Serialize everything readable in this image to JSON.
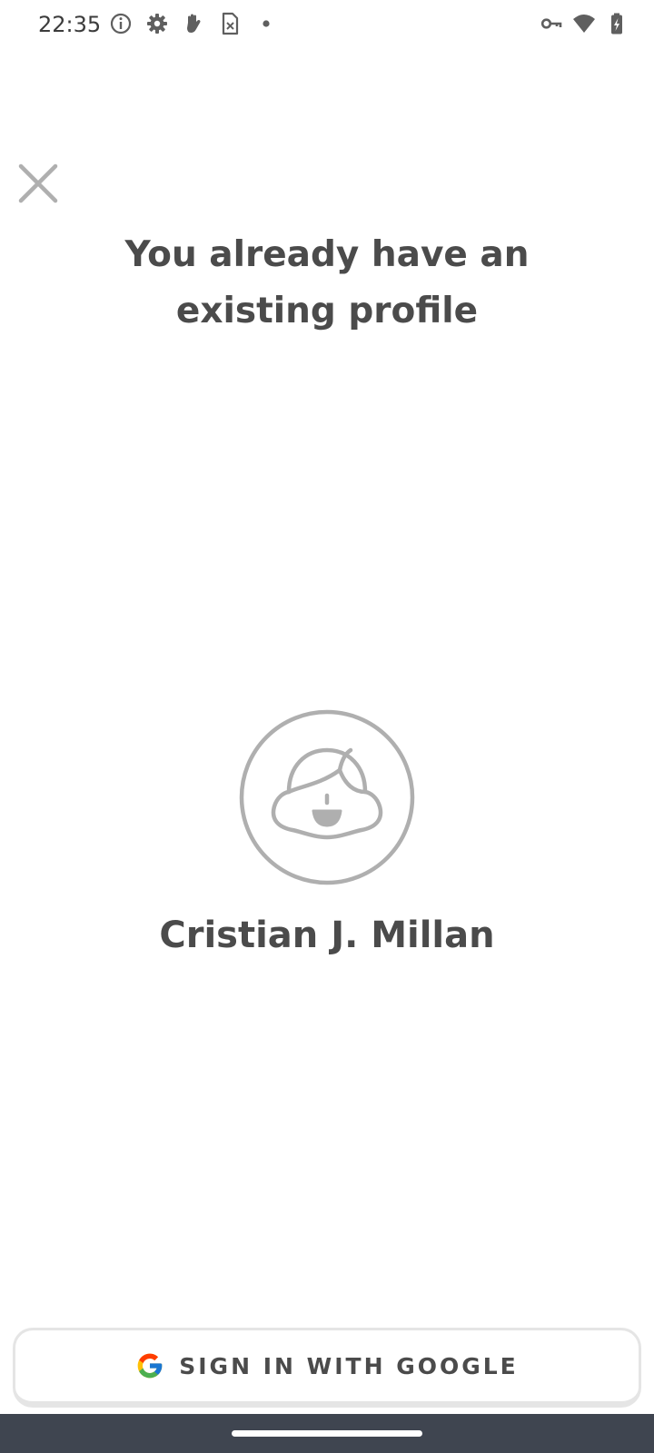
{
  "status_bar": {
    "time": "22:35",
    "left_icons": [
      "info-icon",
      "settings-gear-icon",
      "hand-icon",
      "sim-card-icon",
      "dot-icon"
    ],
    "right_icons": [
      "vpn-key-icon",
      "wifi-icon",
      "battery-charging-icon"
    ]
  },
  "header": {
    "close_icon": "close-icon"
  },
  "main": {
    "title": "You already have an existing profile",
    "avatar_icon": "avatar-face-icon",
    "profile_name": "Cristian J. Millan"
  },
  "footer": {
    "google_button_label": "SIGN IN WITH GOOGLE",
    "google_icon": "google-g-icon"
  },
  "colors": {
    "text": "#4b4b4b",
    "icon_gray": "#afafaf",
    "button_border": "#e5e5e5",
    "nav_bar": "#3f4550",
    "google_blue": "#4285F4",
    "google_red": "#EA4335",
    "google_yellow": "#FBBC05",
    "google_green": "#34A853"
  }
}
